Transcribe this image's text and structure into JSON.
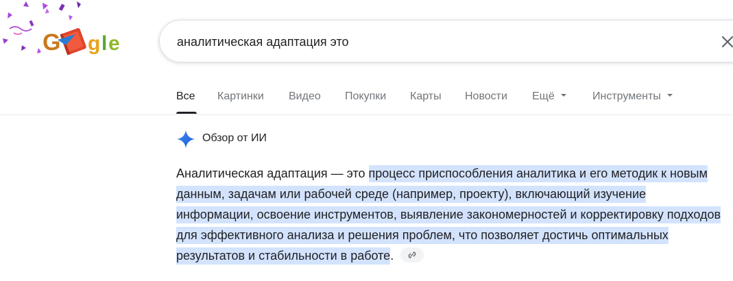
{
  "search": {
    "query": "аналитическая адаптация это"
  },
  "logo": {
    "alt": "Google"
  },
  "tabs": [
    {
      "label": "Все",
      "active": true
    },
    {
      "label": "Картинки"
    },
    {
      "label": "Видео"
    },
    {
      "label": "Покупки"
    },
    {
      "label": "Карты"
    },
    {
      "label": "Новости"
    },
    {
      "label": "Ещё",
      "dropdown": true
    },
    {
      "label": "Инструменты",
      "dropdown": true
    }
  ],
  "ai_overview": {
    "title": "Обзор от ИИ",
    "intro": "Аналитическая адаптация — это ",
    "highlighted": "процесс приспособления аналитика и его методик к новым данным, задачам или рабочей среде (например, проекту), включающий изучение информации, освоение инструментов, выявление закономерностей и корректировку подходов для эффективного анализа и решения проблем, что позволяет достичь оптимальных результатов и стабильности в работе",
    "tail": "."
  },
  "colors": {
    "highlight": "#d3e3fd",
    "tab_inactive": "#70757a",
    "text": "#202124",
    "spark": "#4285f4"
  },
  "icons": {
    "clear": "close-icon",
    "ai": "sparkle-icon",
    "link": "link-icon"
  }
}
